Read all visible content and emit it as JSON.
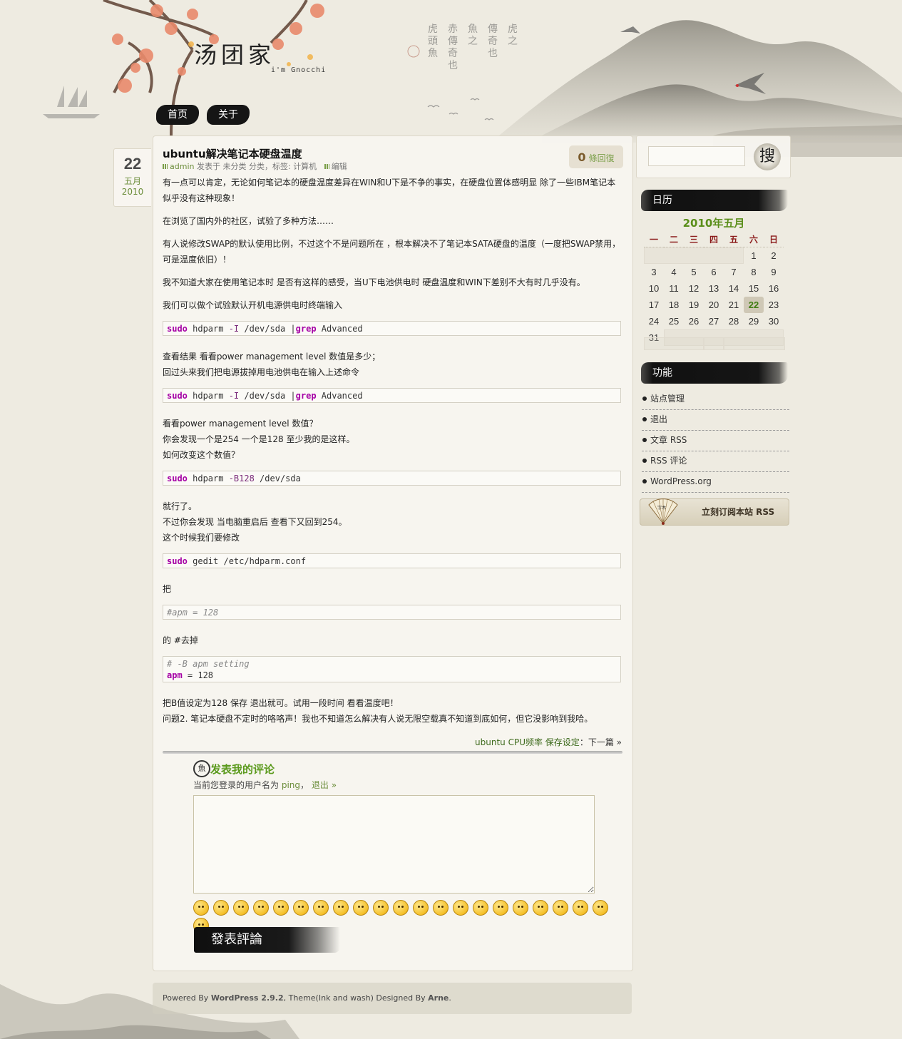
{
  "site": {
    "title": "汤团家",
    "tagline": "i'm Gnocchi"
  },
  "nav": [
    {
      "label": "首页"
    },
    {
      "label": "关于"
    }
  ],
  "post": {
    "date": {
      "day": "22",
      "month": "五月",
      "year": "2010"
    },
    "title": "ubuntu解决笔记本硬盘温度",
    "meta": {
      "author": "admin",
      "posted_in": "发表于",
      "category": "未分类",
      "category_suffix": "分类，标签:",
      "tag": "计算机",
      "edit": "编辑"
    },
    "comment_count": "0",
    "comment_label": "條回復",
    "paragraphs": [
      "有一点可以肯定，无论如何笔记本的硬盘温度差异在WIN和U下是不争的事实，在硬盘位置体感明显 除了一些IBM笔记本似乎没有这种现象！",
      "在浏览了国内外的社区，试验了多种方法……",
      "有人说修改SWAP的默认使用比例，不过这个不是问题所在 ，根本解决不了笔记本SATA硬盘的温度（一度把SWAP禁用，可是温度依旧）！",
      "我不知道大家在使用笔记本时 是否有这样的感受，当U下电池供电时 硬盘温度和WIN下差别不大有时几乎没有。",
      "我们可以做个试验默认开机电源供电时终端输入",
      "查看结果 看看power management level 数值是多少；",
      "回过头来我们把电源拔掉用电池供电在输入上述命令",
      "看看power management level 数值？",
      "你会发现一个是254 一个是128 至少我的是这样。",
      "如何改变这个数值？",
      "就行了。",
      "不过你会发现 当电脑重启后 查看下又回到254。",
      "这个时候我们要修改",
      "把",
      "的 #去掉",
      "把B值设定为128 保存 退出就可。试用一段时间 看看温度吧！",
      "问题2. 笔记本硬盘不定时的咯咯声！我也不知道怎么解决有人说无限空载真不知道到底如何，但它没影响到我哈。"
    ],
    "code": {
      "c1": {
        "kw1": "sudo",
        "mid": " hdparm ",
        "opt": "-I",
        "rest": " /dev/sda |",
        "kw2": "grep",
        "end": " Advanced"
      },
      "c2": {
        "kw1": "sudo",
        "mid": " hdparm ",
        "opt": "-I",
        "rest": " /dev/sda |",
        "kw2": "grep",
        "end": " Advanced"
      },
      "c3": {
        "kw1": "sudo",
        "mid": " hdparm ",
        "opt": "-B128",
        "rest": " /dev/sda"
      },
      "c4": {
        "kw1": "sudo",
        "rest": " gedit /etc/hdparm.conf"
      },
      "c5": {
        "comment": "#apm = 128"
      },
      "c6": {
        "comment": "# -B apm setting",
        "kw": "apm",
        "rest": " = 128"
      }
    },
    "navigation": {
      "prev_link": "ubuntu CPU频率 保存设定",
      "separator": "：",
      "next": "下一篇 »"
    }
  },
  "comment_form": {
    "title": "发表我的评论",
    "login_prefix": "当前您登录的用户名为",
    "username": "ping",
    "login_sep": "，",
    "logout": "退出 »",
    "submit": "發表評論",
    "smiley_count": 22
  },
  "footer": {
    "powered": "Powered By",
    "wp": "WordPress 2.9.2",
    "theme": ", Theme(Ink and wash) Designed By",
    "author": "Arne",
    "end": "."
  },
  "sidebar": {
    "search_button": "搜",
    "calendar": {
      "heading": "日历",
      "caption": "2010年五月",
      "weekdays": [
        "一",
        "二",
        "三",
        "四",
        "五",
        "六",
        "日"
      ],
      "today": 22
    },
    "functions": {
      "heading": "功能",
      "items": [
        "站点管理",
        "退出",
        "文章 RSS",
        "RSS 评论",
        "WordPress.org"
      ]
    },
    "rss_banner": "立刻订阅本站 RSS",
    "fan_text": "字木"
  },
  "colors": {
    "accent_green": "#5a8e1a",
    "ink": "#151515",
    "paper": "#eeebe1",
    "weekday_red": "#8b1a1a"
  },
  "icons": [
    "plum-blossom-branch",
    "ink-mountain",
    "crane-bird",
    "sailboat",
    "search-seal-icon",
    "fan-icon",
    "calligraphy-seal-icon"
  ]
}
